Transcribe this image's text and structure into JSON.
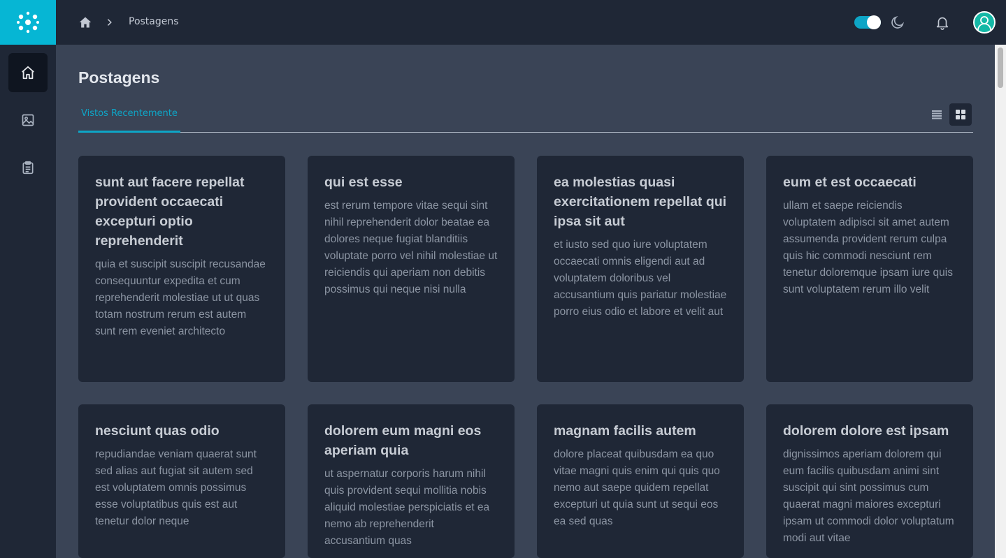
{
  "breadcrumb": {
    "current": "Postagens"
  },
  "page": {
    "title": "Postagens"
  },
  "tabs": [
    {
      "label": "Vistos Recentemente"
    }
  ],
  "colors": {
    "accent": "#0ea5c6",
    "sidebar": "#1f2736",
    "main_bg": "#3a4456"
  },
  "icons": {
    "logo": "dots-logo-icon",
    "home": "home-icon",
    "image": "image-icon",
    "clipboard": "clipboard-icon",
    "moon": "moon-icon",
    "bell": "bell-icon",
    "avatar": "user-avatar-icon",
    "list": "list-view-icon",
    "grid": "grid-view-icon"
  },
  "posts": [
    {
      "title": "sunt aut facere repellat provident occaecati excepturi optio reprehenderit",
      "body": "quia et suscipit suscipit recusandae consequuntur expedita et cum reprehenderit molestiae ut ut quas totam nostrum rerum est autem sunt rem eveniet architecto"
    },
    {
      "title": "qui est esse",
      "body": "est rerum tempore vitae sequi sint nihil reprehenderit dolor beatae ea dolores neque fugiat blanditiis voluptate porro vel nihil molestiae ut reiciendis qui aperiam non debitis possimus qui neque nisi nulla"
    },
    {
      "title": "ea molestias quasi exercitationem repellat qui ipsa sit aut",
      "body": "et iusto sed quo iure voluptatem occaecati omnis eligendi aut ad voluptatem doloribus vel accusantium quis pariatur molestiae porro eius odio et labore et velit aut"
    },
    {
      "title": "eum et est occaecati",
      "body": "ullam et saepe reiciendis voluptatem adipisci sit amet autem assumenda provident rerum culpa quis hic commodi nesciunt rem tenetur doloremque ipsam iure quis sunt voluptatem rerum illo velit"
    },
    {
      "title": "nesciunt quas odio",
      "body": "repudiandae veniam quaerat sunt sed alias aut fugiat sit autem sed est voluptatem omnis possimus esse voluptatibus quis est aut tenetur dolor neque"
    },
    {
      "title": "dolorem eum magni eos aperiam quia",
      "body": "ut aspernatur corporis harum nihil quis provident sequi mollitia nobis aliquid molestiae perspiciatis et ea nemo ab reprehenderit accusantium quas"
    },
    {
      "title": "magnam facilis autem",
      "body": "dolore placeat quibusdam ea quo vitae magni quis enim qui quis quo nemo aut saepe quidem repellat excepturi ut quia sunt ut sequi eos ea sed quas"
    },
    {
      "title": "dolorem dolore est ipsam",
      "body": "dignissimos aperiam dolorem qui eum facilis quibusdam animi sint suscipit qui sint possimus cum quaerat magni maiores excepturi ipsam ut commodi dolor voluptatum modi aut vitae"
    }
  ]
}
